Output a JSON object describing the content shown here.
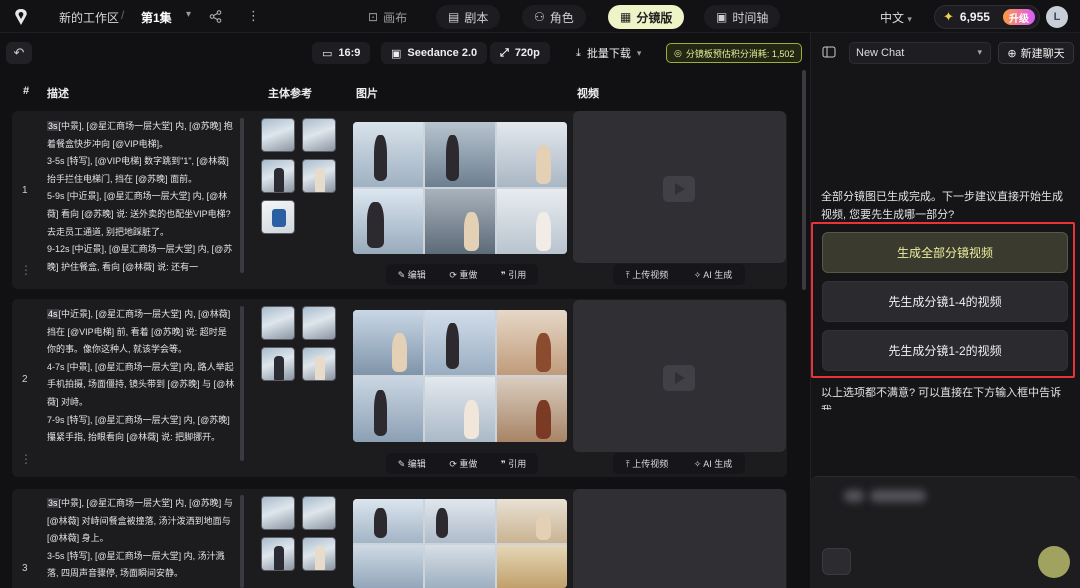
{
  "topbar": {
    "workspace": "新的工作区",
    "separator": "/",
    "episode": "第1集",
    "tabs": [
      {
        "label": "画布",
        "icon": "canvas-icon"
      },
      {
        "label": "剧本",
        "icon": "script-icon"
      },
      {
        "label": "角色",
        "icon": "user-icon"
      },
      {
        "label": "分镜版",
        "icon": "storyboard-icon",
        "active": true
      },
      {
        "label": "时间轴",
        "icon": "film-icon"
      }
    ],
    "language": "中文",
    "credits": "6,955",
    "upgrade": "升级",
    "avatar": "L"
  },
  "toolbar": {
    "ratio": "16:9",
    "model": "Seedance 2.0",
    "resolution": "720p",
    "batch_download": "批量下载",
    "estimate": "分镜板预估积分消耗: 1,502"
  },
  "table": {
    "headers": {
      "num": "#",
      "desc": "描述",
      "subject": "主体参考",
      "image": "图片",
      "video": "视频"
    },
    "rows": [
      {
        "num": "1",
        "lines": [
          {
            "tag": "3s",
            "text": "[中景], [@星汇商场一层大堂] 内, [@苏晚] 抱着餐盒快步冲向 [@VIP电梯]。"
          },
          {
            "tag": "",
            "text": "3-5s [特写], [@VIP电梯] 数字跳到\"1\", [@林薇] 抬手拦住电梯门, 挡在 [@苏晚] 面前。"
          },
          {
            "tag": "",
            "text": "5-9s [中近景], [@星汇商场一层大堂] 内, [@林薇] 看向 [@苏晚] 说: 送外卖的也配坐VIP电梯? 去走员工通道, 别把地踩脏了。"
          },
          {
            "tag": "",
            "text": "9-12s [中近景], [@星汇商场一层大堂] 内, [@苏晚] 护住餐盒, 看向 [@林薇] 说: 还有一"
          }
        ]
      },
      {
        "num": "2",
        "lines": [
          {
            "tag": "4s",
            "text": "[中近景], [@星汇商场一层大堂] 内, [@林薇] 挡在 [@VIP电梯] 前, 看着 [@苏晚] 说: 超时是你的事。像你这种人, 就该学会等。"
          },
          {
            "tag": "",
            "text": "4-7s [中景], [@星汇商场一层大堂] 内, 路人举起手机拍摄, 场面僵持, 镜头带到 [@苏晚] 与 [@林薇] 对峙。"
          },
          {
            "tag": "",
            "text": "7-9s [特写], [@星汇商场一层大堂] 内, [@苏晚] 攥紧手指, 抬眼看向 [@林薇] 说: 把脚挪开。"
          }
        ]
      },
      {
        "num": "3",
        "lines": [
          {
            "tag": "3s",
            "text": "[中景], [@星汇商场一层大堂] 内, [@苏晚] 与 [@林薇] 对峙间餐盒被撞落, 汤汁泼洒到地面与 [@林薇] 身上。"
          },
          {
            "tag": "",
            "text": "3-5s [特写], [@星汇商场一层大堂] 内, 汤汁溅落, 四周声音骤停, 场面瞬间安静。"
          }
        ]
      }
    ],
    "image_actions": {
      "edit": "编辑",
      "redo": "重做",
      "quote": "引用"
    },
    "video_actions": {
      "upload": "上传视频",
      "ai": "AI 生成"
    }
  },
  "chat": {
    "selector": "New Chat",
    "new_chat": "新建聊天",
    "message": "全部分镜图已生成完成。下一步建议直接开始生成视频, 您要先生成哪一部分?",
    "options": [
      "生成全部分镜视频",
      "先生成分镜1-4的视频",
      "先生成分镜1-2的视频"
    ],
    "followup": "以上选项都不满意? 可以直接在下方输入框中告诉我"
  },
  "colors": {
    "accent": "#eef3c8",
    "highlight_frame": "#e8333b",
    "upgrade_from": "#ff9a3c",
    "upgrade_to": "#d95cff"
  }
}
